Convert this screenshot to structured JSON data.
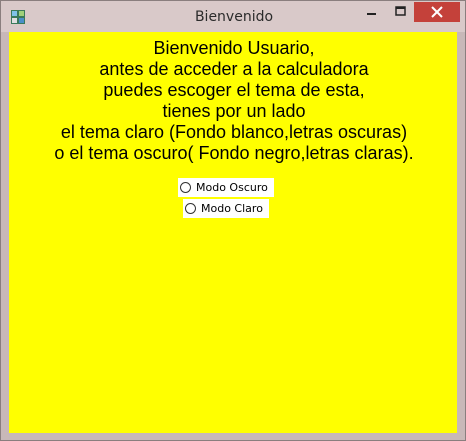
{
  "window": {
    "title": "Bienvenido",
    "icons": {
      "app": "app-icon",
      "minimize": "minimize-icon",
      "maximize": "maximize-icon",
      "close": "close-icon"
    },
    "colors": {
      "background": "#ffff00",
      "close_button": "#c4413a",
      "titlebar": "#d9c9c9"
    }
  },
  "message": {
    "lines": [
      "Bienvenido Usuario,",
      "antes de acceder a la calculadora",
      "puedes escoger el tema de esta,",
      "tienes por un lado",
      "el tema claro (Fondo blanco,letras oscuras)",
      "o el tema oscuro( Fondo negro,letras claras)."
    ]
  },
  "options": [
    {
      "label": "Modo Oscuro",
      "checked": false
    },
    {
      "label": "Modo Claro",
      "checked": false
    }
  ]
}
